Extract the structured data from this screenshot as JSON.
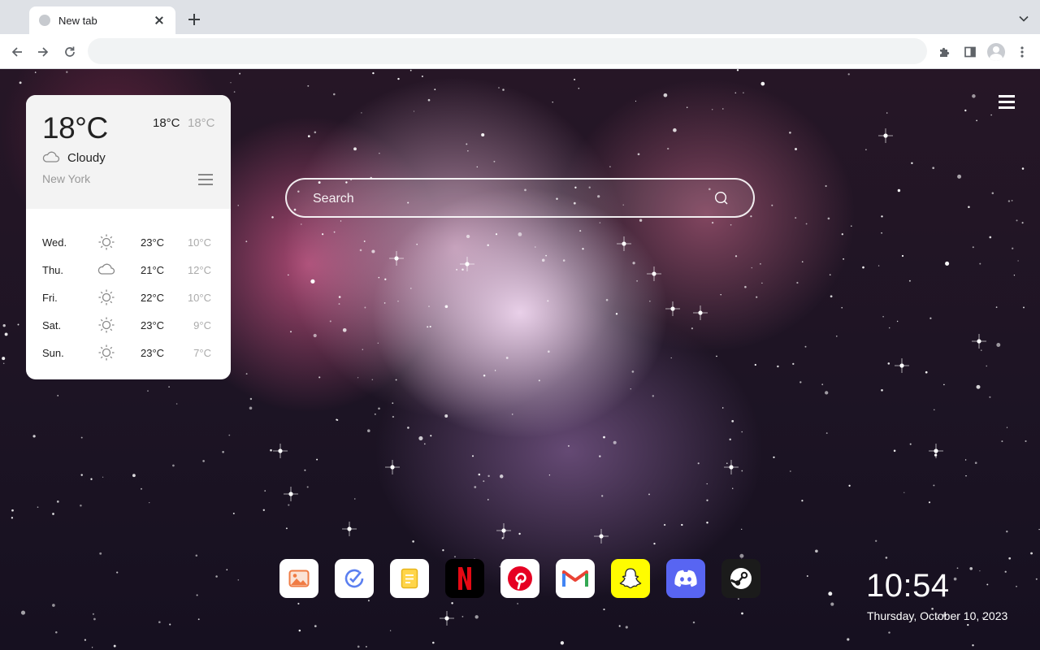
{
  "browser": {
    "tab_title": "New tab",
    "address": ""
  },
  "weather": {
    "current_temp": "18°C",
    "high": "18°C",
    "low": "18°C",
    "condition": "Cloudy",
    "condition_icon": "cloud-icon",
    "city": "New York",
    "forecast": [
      {
        "day": "Wed.",
        "icon": "sun-icon",
        "high": "23°C",
        "low": "10°C"
      },
      {
        "day": "Thu.",
        "icon": "cloud-icon",
        "high": "21°C",
        "low": "12°C"
      },
      {
        "day": "Fri.",
        "icon": "sun-icon",
        "high": "22°C",
        "low": "10°C"
      },
      {
        "day": "Sat.",
        "icon": "sun-icon",
        "high": "23°C",
        "low": "9°C"
      },
      {
        "day": "Sun.",
        "icon": "sun-icon",
        "high": "23°C",
        "low": "7°C"
      }
    ]
  },
  "search": {
    "placeholder": "Search"
  },
  "dock": [
    {
      "name": "photos",
      "color": "#ffffff"
    },
    {
      "name": "task",
      "color": "#ffffff"
    },
    {
      "name": "notes",
      "color": "#ffffff"
    },
    {
      "name": "netflix",
      "color": "#000000"
    },
    {
      "name": "pinterest",
      "color": "#ffffff"
    },
    {
      "name": "gmail",
      "color": "#ffffff"
    },
    {
      "name": "snapchat",
      "color": "#fffc00"
    },
    {
      "name": "discord",
      "color": "#5865f2"
    },
    {
      "name": "steam",
      "color": "#1b1b1b"
    }
  ],
  "clock": {
    "time": "10:54",
    "date": "Thursday, October 10, 2023"
  }
}
